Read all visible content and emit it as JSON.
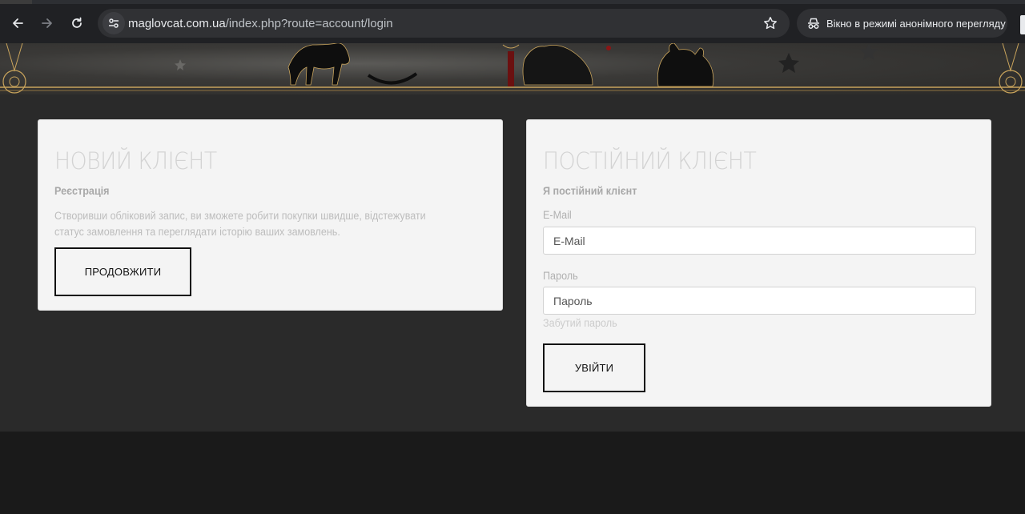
{
  "browser": {
    "url_host": "maglovcat.com.ua",
    "url_path": "/index.php?route=account/login",
    "incognito_label": "Вікно в режимі анонімного перегляду",
    "icons": [
      "back-arrow-icon",
      "forward-arrow-icon",
      "reload-icon",
      "site-settings-icon",
      "bookmark-star-icon",
      "incognito-icon"
    ]
  },
  "new_customer": {
    "title": "НОВИЙ КЛІЄНТ",
    "subtitle": "Реєстрація",
    "text": "Створивши обліковий запис, ви зможете робити покупки швидше, відстежувати статус замовлення та переглядати історію ваших замовлень.",
    "button": "ПРОДОВЖИТИ"
  },
  "returning_customer": {
    "title": "ПОСТІЙНИЙ КЛІЄНТ",
    "subtitle": "Я постійний клієнт",
    "email_label": "E-Mail",
    "email_placeholder": "E-Mail",
    "email_value": "",
    "password_label": "Пароль",
    "password_placeholder": "Пароль",
    "password_value": "",
    "forgot": "Забутий пароль",
    "button": "УВІЙТИ"
  },
  "colors": {
    "browser_bg": "#202124",
    "omnibox_bg": "#303134",
    "main_bg": "#2a2a2a",
    "panel_bg": "#f4f4f4",
    "banner_gold": "#c9a45c",
    "footer_bg": "#1a1a1a"
  }
}
